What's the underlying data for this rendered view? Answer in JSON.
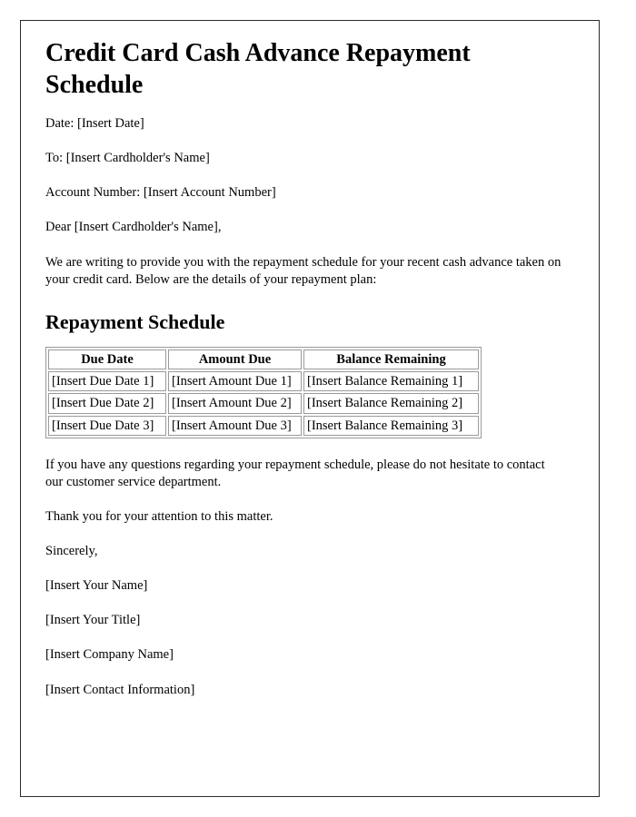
{
  "document": {
    "title": "Credit Card Cash Advance Repayment Schedule",
    "meta_lines": [
      "Date: [Insert Date]",
      "To: [Insert Cardholder's Name]",
      "Account Number: [Insert Account Number]"
    ],
    "salutation": "Dear [Insert Cardholder's Name],",
    "intro_paragraph": "We are writing to provide you with the repayment schedule for your recent cash advance taken on your credit card. Below are the details of your repayment plan:",
    "section_heading": "Repayment Schedule",
    "table": {
      "headers": [
        "Due Date",
        "Amount Due",
        "Balance Remaining"
      ],
      "rows": [
        [
          "[Insert Due Date 1]",
          "[Insert Amount Due 1]",
          "[Insert Balance Remaining 1]"
        ],
        [
          "[Insert Due Date 2]",
          "[Insert Amount Due 2]",
          "[Insert Balance Remaining 2]"
        ],
        [
          "[Insert Due Date 3]",
          "[Insert Amount Due 3]",
          "[Insert Balance Remaining 3]"
        ]
      ]
    },
    "closing_paragraphs": [
      "If you have any questions regarding your repayment schedule, please do not hesitate to contact our customer service department.",
      "Thank you for your attention to this matter.",
      "Sincerely,"
    ],
    "signature_lines": [
      "[Insert Your Name]",
      "[Insert Your Title]",
      "[Insert Company Name]",
      "[Insert Contact Information]"
    ]
  },
  "colors": {
    "page_background": "#ffffff",
    "text": "#000000",
    "page_border": "#2b2b2b",
    "table_border": "#9a9a9a"
  }
}
